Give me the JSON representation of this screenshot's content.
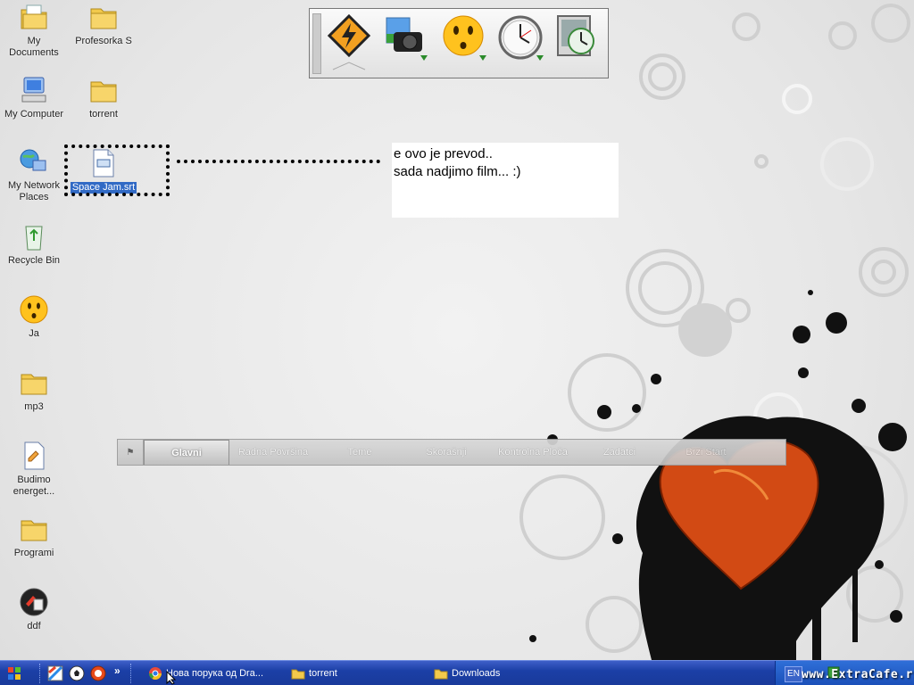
{
  "desktop": {
    "icons": [
      {
        "label": "My Documents",
        "icon": "my-documents-icon"
      },
      {
        "label": "Profesorka S",
        "icon": "folder-icon"
      },
      {
        "label": "My Computer",
        "icon": "my-computer-icon"
      },
      {
        "label": "torrent",
        "icon": "folder-icon"
      },
      {
        "label": "My Network Places",
        "icon": "network-places-icon"
      },
      {
        "label": "Space Jam.srt",
        "icon": "text-file-icon",
        "selected": true
      },
      {
        "label": "Recycle Bin",
        "icon": "recycle-bin-icon"
      },
      {
        "label": "Ja",
        "icon": "smiley-icon"
      },
      {
        "label": "mp3",
        "icon": "folder-icon"
      },
      {
        "label": "Budimo energet...",
        "icon": "document-icon"
      },
      {
        "label": "Programi",
        "icon": "folder-icon"
      },
      {
        "label": "ddf",
        "icon": "program-icon"
      }
    ]
  },
  "note": {
    "line1": "e ovo je prevod..",
    "line2": "sada nadjimo film...  :)"
  },
  "dock": {
    "items": [
      "winamp-icon",
      "camera-icon",
      "smiley-icon",
      "clock-icon",
      "monitor-clock-icon"
    ]
  },
  "tabbar": {
    "tabs": [
      "Glavni",
      "Radna Površina",
      "Teme",
      "Skorašnji",
      "Kontrolna Ploča",
      "Zadatci",
      "Brzi Start"
    ],
    "active": "Glavni"
  },
  "taskbar": {
    "tasks": [
      {
        "label": "Нова порука од Dra...",
        "icon": "chrome-icon"
      },
      {
        "label": "torrent",
        "icon": "folder-icon"
      },
      {
        "label": "Downloads",
        "icon": "folder-icon"
      }
    ],
    "chevron": "»",
    "language": "EN"
  },
  "watermark": "www.ExtraCafe.rs"
}
